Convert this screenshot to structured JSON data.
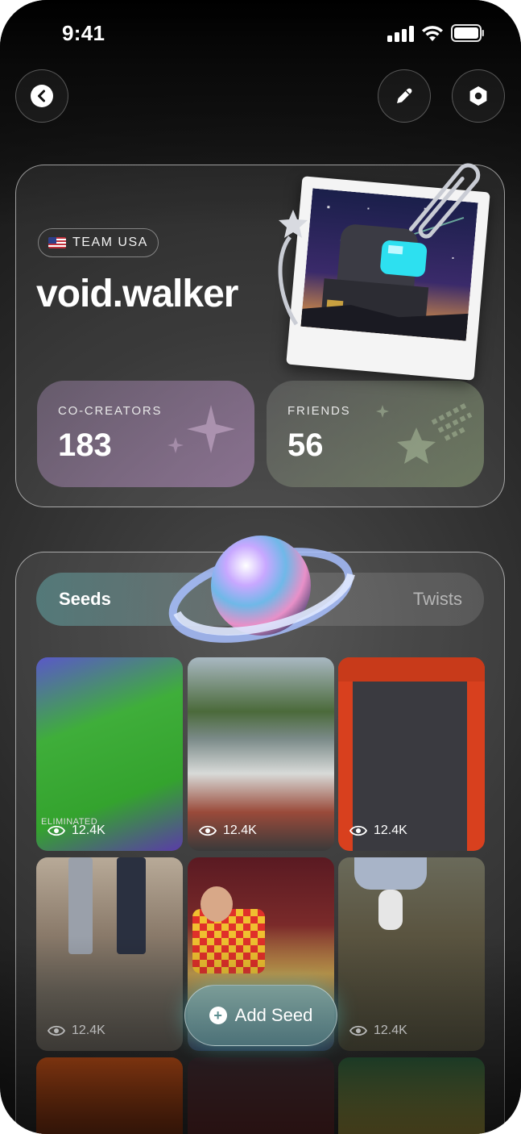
{
  "status": {
    "time": "9:41"
  },
  "profile": {
    "team_label": "TEAM USA",
    "username": "void.walker",
    "stats": [
      {
        "label": "CO-CREATORS",
        "value": "183"
      },
      {
        "label": "FRIENDS",
        "value": "56"
      }
    ]
  },
  "tabs": {
    "seeds": "Seeds",
    "twists": "Twists"
  },
  "grid": [
    {
      "views": "12.4K",
      "overlay_text": "ELIMINATED"
    },
    {
      "views": "12.4K"
    },
    {
      "views": "12.4K"
    },
    {
      "views": "12.4K"
    },
    {
      "views": ""
    },
    {
      "views": "12.4K"
    }
  ],
  "add_seed": {
    "label": "Add Seed"
  },
  "icons": [
    "back-icon",
    "edit-icon",
    "settings-icon",
    "eye-icon",
    "plus-icon",
    "sparkle-icon",
    "star-icon"
  ],
  "colors": {
    "accent_teal": "#5b8e90",
    "stat_purple": "#b48cbe",
    "stat_green": "#8ca078"
  }
}
